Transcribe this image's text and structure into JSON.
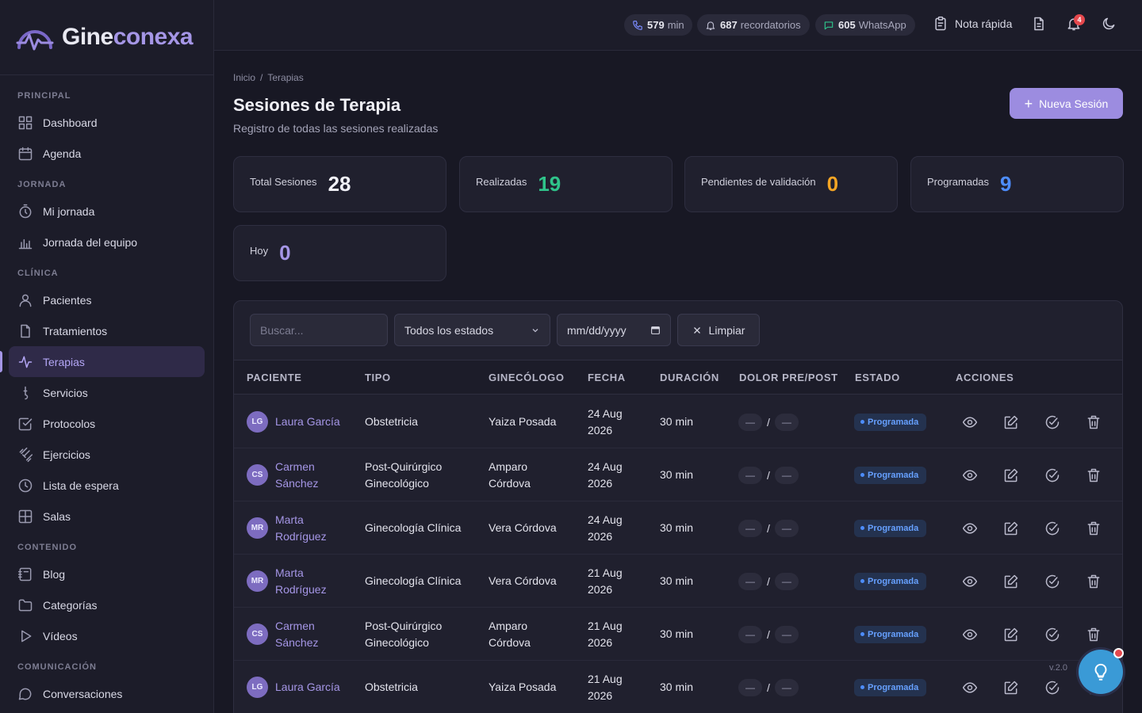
{
  "brand": {
    "part1": "Gine",
    "part2": "conexa"
  },
  "sidebar": {
    "sections": [
      {
        "title": "PRINCIPAL",
        "items": [
          {
            "label": "Dashboard",
            "icon": "grid-icon"
          },
          {
            "label": "Agenda",
            "icon": "calendar-icon"
          }
        ]
      },
      {
        "title": "JORNADA",
        "items": [
          {
            "label": "Mi jornada",
            "icon": "stopwatch-icon"
          },
          {
            "label": "Jornada del equipo",
            "icon": "bar-chart-icon"
          }
        ]
      },
      {
        "title": "CLÍNICA",
        "items": [
          {
            "label": "Pacientes",
            "icon": "user-icon"
          },
          {
            "label": "Tratamientos",
            "icon": "file-icon"
          },
          {
            "label": "Terapias",
            "icon": "activity-icon",
            "active": true
          },
          {
            "label": "Servicios",
            "icon": "stethoscope-icon"
          },
          {
            "label": "Protocolos",
            "icon": "check-square-icon"
          },
          {
            "label": "Ejercicios",
            "icon": "dumbbell-icon"
          },
          {
            "label": "Lista de espera",
            "icon": "clock-icon"
          },
          {
            "label": "Salas",
            "icon": "layout-icon"
          }
        ]
      },
      {
        "title": "CONTENIDO",
        "items": [
          {
            "label": "Blog",
            "icon": "notebook-icon"
          },
          {
            "label": "Categorías",
            "icon": "folder-icon"
          },
          {
            "label": "Vídeos",
            "icon": "play-icon"
          }
        ]
      },
      {
        "title": "COMUNICACIÓN",
        "items": [
          {
            "label": "Conversaciones",
            "icon": "chat-icon"
          }
        ]
      }
    ]
  },
  "topbar": {
    "calls": {
      "value": "579",
      "unit": "min"
    },
    "reminders": {
      "value": "687",
      "unit": "recordatorios"
    },
    "whatsapp": {
      "value": "605",
      "unit": "WhatsApp"
    },
    "quick_note": "Nota rápida",
    "notifications_count": "4"
  },
  "breadcrumb": {
    "home": "Inicio",
    "sep": "/",
    "current": "Terapias"
  },
  "page": {
    "title": "Sesiones de Terapia",
    "subtitle": "Registro de todas las sesiones realizadas",
    "new_button": "Nueva Sesión"
  },
  "stats": [
    {
      "label": "Total Sesiones",
      "value": "28",
      "color": "#f1f1f7"
    },
    {
      "label": "Realizadas",
      "value": "19",
      "color": "#2fc38a"
    },
    {
      "label": "Pendientes de validación",
      "value": "0",
      "color": "#f5a524"
    },
    {
      "label": "Programadas",
      "value": "9",
      "color": "#4d8dff"
    },
    {
      "label": "Hoy",
      "value": "0",
      "color": "#a596e6"
    }
  ],
  "filters": {
    "search_placeholder": "Buscar...",
    "status_selected": "Todos los estados",
    "date_placeholder": "mm/dd/yyyy",
    "clear_label": "Limpiar"
  },
  "table": {
    "headers": [
      "PACIENTE",
      "TIPO",
      "GINECÓLOGO",
      "FECHA",
      "DURACIÓN",
      "DOLOR PRE/POST",
      "ESTADO",
      "ACCIONES"
    ],
    "rows": [
      {
        "initials": "LG",
        "patient": [
          "Laura García"
        ],
        "type": [
          "Obstetricia"
        ],
        "doctor": [
          "Yaiza Posada"
        ],
        "date": [
          "24 Aug",
          "2026"
        ],
        "duration": "30 min",
        "pain_pre": "—",
        "pain_post": "—",
        "status": "Programada"
      },
      {
        "initials": "CS",
        "patient": [
          "Carmen",
          "Sánchez"
        ],
        "type": [
          "Post-Quirúrgico",
          "Ginecológico"
        ],
        "doctor": [
          "Amparo",
          "Córdova"
        ],
        "date": [
          "24 Aug",
          "2026"
        ],
        "duration": "30 min",
        "pain_pre": "—",
        "pain_post": "—",
        "status": "Programada"
      },
      {
        "initials": "MR",
        "patient": [
          "Marta",
          "Rodríguez"
        ],
        "type": [
          "Ginecología Clínica"
        ],
        "doctor": [
          "Vera Córdova"
        ],
        "date": [
          "24 Aug",
          "2026"
        ],
        "duration": "30 min",
        "pain_pre": "—",
        "pain_post": "—",
        "status": "Programada"
      },
      {
        "initials": "MR",
        "patient": [
          "Marta",
          "Rodríguez"
        ],
        "type": [
          "Ginecología Clínica"
        ],
        "doctor": [
          "Vera Córdova"
        ],
        "date": [
          "21 Aug",
          "2026"
        ],
        "duration": "30 min",
        "pain_pre": "—",
        "pain_post": "—",
        "status": "Programada"
      },
      {
        "initials": "CS",
        "patient": [
          "Carmen",
          "Sánchez"
        ],
        "type": [
          "Post-Quirúrgico",
          "Ginecológico"
        ],
        "doctor": [
          "Amparo",
          "Córdova"
        ],
        "date": [
          "21 Aug",
          "2026"
        ],
        "duration": "30 min",
        "pain_pre": "—",
        "pain_post": "—",
        "status": "Programada"
      },
      {
        "initials": "LG",
        "patient": [
          "Laura García"
        ],
        "type": [
          "Obstetricia"
        ],
        "doctor": [
          "Yaiza Posada"
        ],
        "date": [
          "21 Aug",
          "2026"
        ],
        "duration": "30 min",
        "pain_pre": "—",
        "pain_post": "—",
        "status": "Programada"
      }
    ]
  },
  "version": "v.2.0",
  "colors": {
    "accent": "#a596e6",
    "status_scheduled": "#4d8dff",
    "help_button": "#3a9ad6"
  }
}
